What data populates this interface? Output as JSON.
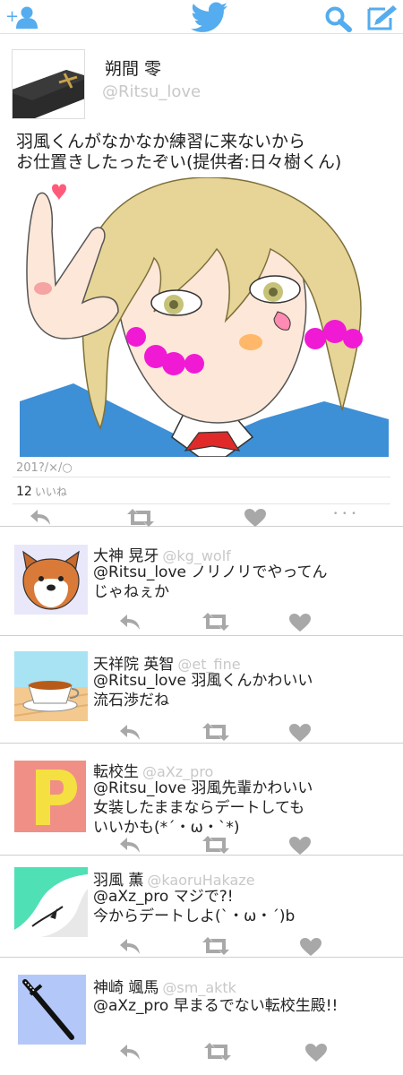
{
  "colors": {
    "brand": "#55acee",
    "icon_gray": "#a8a8a8",
    "handle_gray": "#c8c8c8"
  },
  "topbar": {
    "icons": [
      "add-user-icon",
      "twitter-bird-icon",
      "search-icon",
      "compose-icon"
    ],
    "add_glyph": "+"
  },
  "main_tweet": {
    "name": "朔間 零",
    "handle": "@Ritsu_love",
    "text": "羽風くんがなかなか練習に来ないから\nお仕置きしたったぞい(提供者:日々樹くん)",
    "date": "201?/×/○",
    "likes_count": "12",
    "likes_label": "いいね",
    "actions": [
      "reply-icon",
      "retweet-icon",
      "like-icon",
      "more-icon"
    ],
    "more_glyph": "• • •"
  },
  "replies": [
    {
      "name": "大神 晃牙",
      "handle": "@kg_wolf",
      "text": "@Ritsu_love ノリノリでやってん\nじゃねぇか"
    },
    {
      "name": "天祥院 英智",
      "handle": "@et_fine",
      "text": "@Ritsu_love 羽風くんかわいい\n流石渉だね"
    },
    {
      "name": "転校生",
      "handle": "@aXz_pro",
      "text": "@Ritsu_love 羽風先輩かわいい\n女装したままならデートしても\nいいかも(*´・ω・`*)"
    },
    {
      "name": "羽風 薫",
      "handle": "@kaoruHakaze",
      "text": "@aXz_pro マジで?!\n今からデートしよ(`・ω・´)b"
    },
    {
      "name": "神崎 颯馬",
      "handle": "@sm_aktk",
      "text": "@aXz_pro 早まるでない転校生殿!!"
    }
  ]
}
